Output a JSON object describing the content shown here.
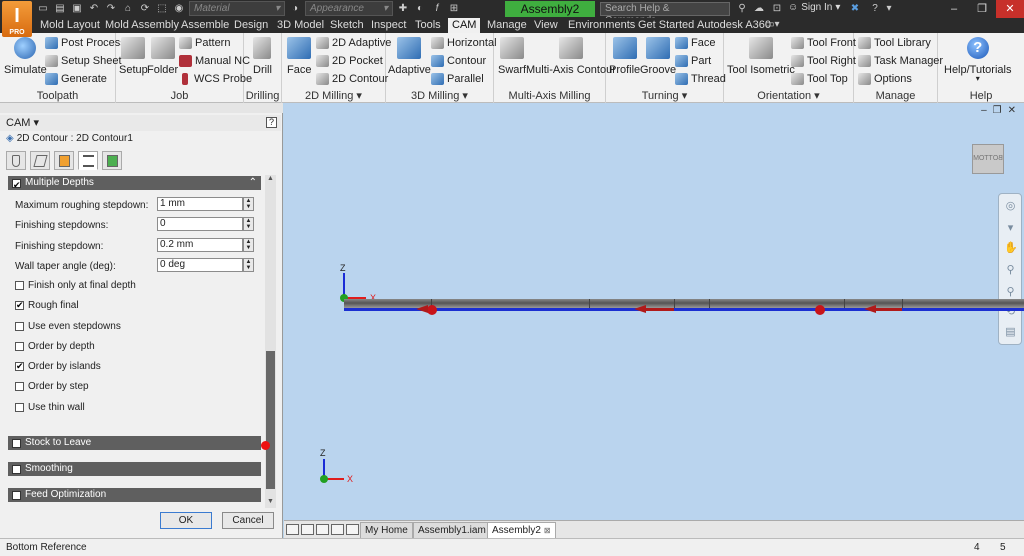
{
  "app": {
    "logo_letter": "I",
    "logo_sub": "PRO",
    "document_title": "Assembly2",
    "material_placeholder": "Material",
    "appearance_placeholder": "Appearance",
    "help_search_placeholder": "Search Help & Commands...",
    "sign_in": "Sign In"
  },
  "tabs": [
    {
      "label": "Mold Layout"
    },
    {
      "label": "Mold Assembly"
    },
    {
      "label": "Assemble"
    },
    {
      "label": "Design"
    },
    {
      "label": "3D Model"
    },
    {
      "label": "Sketch"
    },
    {
      "label": "Inspect"
    },
    {
      "label": "Tools"
    },
    {
      "label": "CAM",
      "active": true
    },
    {
      "label": "Manage"
    },
    {
      "label": "View"
    },
    {
      "label": "Environments"
    },
    {
      "label": "Get Started"
    },
    {
      "label": "Autodesk A360"
    }
  ],
  "ribbon": {
    "toolpath": {
      "title": "Toolpath",
      "simulate": "Simulate",
      "post_process": "Post Process",
      "setup_sheet": "Setup Sheet",
      "generate": "Generate"
    },
    "job": {
      "title": "Job",
      "setup": "Setup",
      "folder": "Folder",
      "pattern": "Pattern",
      "manual_nc": "Manual NC",
      "wcs_probe": "WCS Probe"
    },
    "drilling": {
      "title": "Drilling",
      "drill": "Drill"
    },
    "milling2d": {
      "title": "2D Milling",
      "face": "Face",
      "adaptive": "2D Adaptive",
      "pocket": "2D Pocket",
      "contour": "2D Contour"
    },
    "milling3d": {
      "title": "3D Milling",
      "adaptive": "Adaptive",
      "horizontal": "Horizontal",
      "contour": "Contour",
      "parallel": "Parallel"
    },
    "multiaxis": {
      "title": "Multi-Axis Milling",
      "swarf": "Swarf",
      "multi_axis_contour": "Multi-Axis Contour"
    },
    "turning": {
      "title": "Turning",
      "profile": "Profile",
      "groove": "Groove",
      "face": "Face",
      "part": "Part",
      "thread": "Thread"
    },
    "orientation": {
      "title": "Orientation",
      "tool_isometric": "Tool Isometric",
      "tool_front": "Tool Front",
      "tool_right": "Tool Right",
      "tool_top": "Tool Top"
    },
    "manage": {
      "title": "Manage",
      "tool_library": "Tool Library",
      "task_manager": "Task Manager",
      "options": "Options"
    },
    "help": {
      "title": "Help",
      "help_tutorials": "Help/Tutorials"
    }
  },
  "panel": {
    "header": "CAM",
    "breadcrumb": "2D Contour : 2D Contour1",
    "section_multiple_depths": "Multiple Depths",
    "fields": {
      "max_roughing_stepdown_label": "Maximum roughing stepdown:",
      "max_roughing_stepdown_value": "1 mm",
      "finishing_stepdowns_label": "Finishing stepdowns:",
      "finishing_stepdowns_value": "0",
      "finishing_stepdown_label": "Finishing stepdown:",
      "finishing_stepdown_value": "0.2 mm",
      "wall_taper_label": "Wall taper angle (deg):",
      "wall_taper_value": "0 deg"
    },
    "checkboxes": [
      {
        "label": "Finish only at final depth",
        "checked": false
      },
      {
        "label": "Rough final",
        "checked": true
      },
      {
        "label": "Use even stepdowns",
        "checked": false
      },
      {
        "label": "Order by depth",
        "checked": false
      },
      {
        "label": "Order by islands",
        "checked": true
      },
      {
        "label": "Order by step",
        "checked": false
      },
      {
        "label": "Use thin wall",
        "checked": false
      }
    ],
    "section_stock_to_leave": "Stock to Leave",
    "section_smoothing": "Smoothing",
    "section_feed_optimization": "Feed Optimization",
    "ok": "OK",
    "cancel": "Cancel"
  },
  "viewport": {
    "viewcube_label": "BOTTOM",
    "axis_z": "Z",
    "axis_x": "X"
  },
  "doc_tabs": [
    {
      "label": "My Home"
    },
    {
      "label": "Assembly1.iam"
    },
    {
      "label": "Assembly2",
      "active": true
    }
  ],
  "status": {
    "text": "Bottom Reference",
    "num1": "4",
    "num2": "5"
  },
  "colors": {
    "accent_orange": "#f39c3a",
    "active_doc_green": "#3fae3f",
    "viewport_bg": "#bad4ee",
    "toolpath_blue": "#1b2fd1",
    "arrow_red": "#b01a1a"
  }
}
